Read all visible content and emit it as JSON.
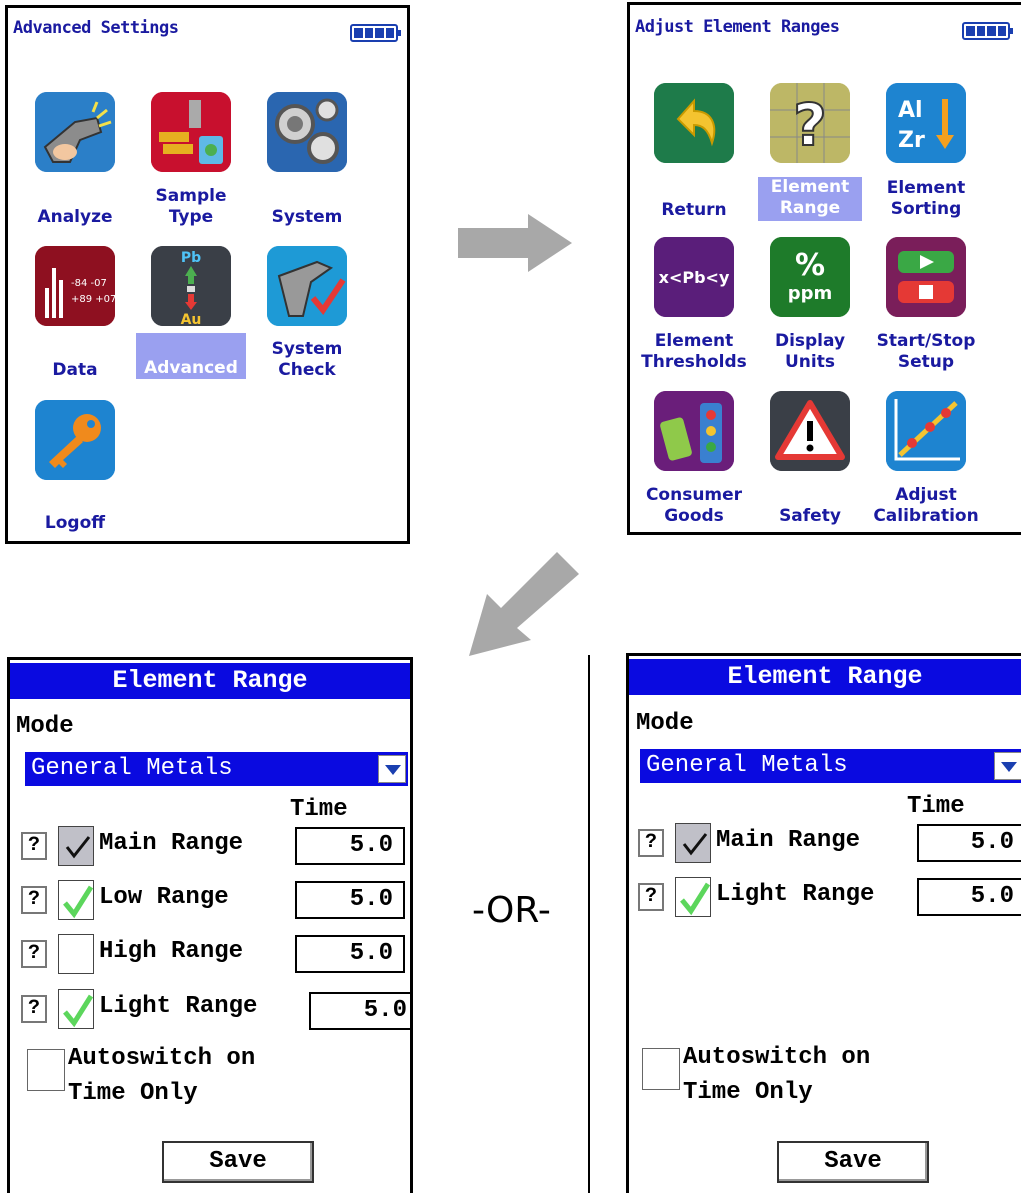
{
  "advanced_settings": {
    "title": "Advanced Settings",
    "icons": [
      {
        "label": "Analyze",
        "icon": "analyzer-gun-icon"
      },
      {
        "label": "Sample\nType",
        "icon": "sample-type-icon"
      },
      {
        "label": "System",
        "icon": "gears-icon"
      },
      {
        "label": "Data",
        "icon": "data-icon"
      },
      {
        "label": "Advanced",
        "icon": "advanced-icon",
        "selected": true
      },
      {
        "label": "System\nCheck",
        "icon": "system-check-icon"
      },
      {
        "label": "Logoff",
        "icon": "key-icon"
      }
    ]
  },
  "adjust_element_ranges": {
    "title": "Adjust Element Ranges",
    "icons": [
      {
        "label": "Return",
        "icon": "return-arrow-icon"
      },
      {
        "label": "Element\nRange",
        "icon": "element-range-icon",
        "selected": true
      },
      {
        "label": "Element\nSorting",
        "icon": "element-sorting-icon"
      },
      {
        "label": "Element\nThresholds",
        "icon": "element-thresholds-icon"
      },
      {
        "label": "Display\nUnits",
        "icon": "display-units-icon"
      },
      {
        "label": "Start/Stop\nSetup",
        "icon": "start-stop-icon"
      },
      {
        "label": "Consumer\nGoods",
        "icon": "consumer-goods-icon"
      },
      {
        "label": "Safety",
        "icon": "safety-warning-icon"
      },
      {
        "label": "Adjust\nCalibration",
        "icon": "calibration-icon"
      }
    ],
    "glyphs": {
      "sorting_top": "Al",
      "sorting_bottom": "Zr",
      "thresholds": "x<Pb<y",
      "units_top": "%",
      "units_bottom": "ppm",
      "advanced_top": "Pb",
      "advanced_bottom": "Au"
    }
  },
  "separator": "-OR-",
  "element_range_left": {
    "title": "Element Range",
    "mode_label": "Mode",
    "mode_value": "General Metals",
    "time_header": "Time",
    "rows": [
      {
        "label": "Main Range",
        "checked": true,
        "style": "gray",
        "time": "5.0"
      },
      {
        "label": "Low Range",
        "checked": true,
        "style": "green",
        "time": "5.0"
      },
      {
        "label": "High Range",
        "checked": false,
        "style": "none",
        "time": "5.0"
      },
      {
        "label": "Light Range",
        "checked": true,
        "style": "green",
        "time": "5.0"
      }
    ],
    "help_label": "?",
    "autoswitch_line1": "Autoswitch on",
    "autoswitch_line2": "Time Only",
    "save_label": "Save"
  },
  "element_range_right": {
    "title": "Element Range",
    "mode_label": "Mode",
    "mode_value": "General Metals",
    "time_header": "Time",
    "rows": [
      {
        "label": "Main Range",
        "checked": true,
        "style": "gray",
        "time": "5.0"
      },
      {
        "label": "Light Range",
        "checked": true,
        "style": "green",
        "time": "5.0"
      }
    ],
    "help_label": "?",
    "autoswitch_line1": "Autoswitch on",
    "autoswitch_line2": "Time Only",
    "save_label": "Save"
  }
}
